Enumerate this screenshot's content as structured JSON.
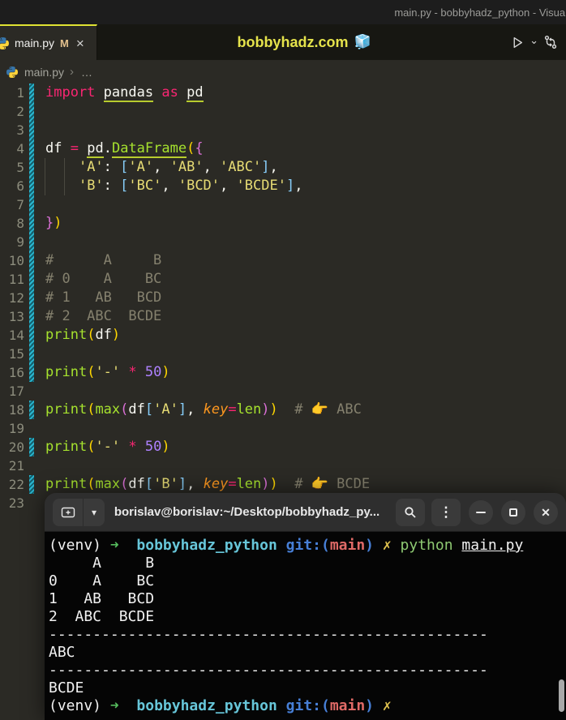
{
  "window": {
    "title": "main.py - bobbyhadz_python - Visual"
  },
  "tabbar": {
    "tab": {
      "label": "main.py",
      "modified_badge": "M",
      "close_glyph": "×"
    },
    "watermark": {
      "label": "bobbyhadz.com",
      "emoji": "🧊"
    }
  },
  "icons": {
    "run": "▷",
    "run_dropdown": "⌄",
    "terminal_dropdown": "▾",
    "menu_kebab": "⋮"
  },
  "breadcrumb": {
    "file": "main.py",
    "separator": "›",
    "ellipsis": "…"
  },
  "editor": {
    "lines": [
      {
        "n": 1,
        "mod": true,
        "seg": [
          [
            "import",
            "kw"
          ],
          [
            " ",
            "w"
          ],
          [
            "pandas",
            "wu"
          ],
          [
            " ",
            "w"
          ],
          [
            "as",
            "kw"
          ],
          [
            " ",
            "w"
          ],
          [
            "pd",
            "wu"
          ]
        ]
      },
      {
        "n": 2,
        "mod": true,
        "seg": []
      },
      {
        "n": 3,
        "mod": true,
        "seg": []
      },
      {
        "n": 4,
        "mod": true,
        "seg": [
          [
            "df",
            "w"
          ],
          [
            " ",
            "w"
          ],
          [
            "=",
            "kw"
          ],
          [
            " ",
            "w"
          ],
          [
            "pd",
            "wu"
          ],
          [
            ".",
            "w"
          ],
          [
            "DataFrame",
            "fnu"
          ],
          [
            "(",
            "b1"
          ],
          [
            "{",
            "b2"
          ]
        ]
      },
      {
        "n": 5,
        "mod": true,
        "guides": [
          13,
          37
        ],
        "seg": [
          [
            "    ",
            "w"
          ],
          [
            "'A'",
            "str"
          ],
          [
            ": ",
            "w"
          ],
          [
            "[",
            "b3"
          ],
          [
            "'A'",
            "str"
          ],
          [
            ", ",
            "w"
          ],
          [
            "'AB'",
            "str"
          ],
          [
            ", ",
            "w"
          ],
          [
            "'ABC'",
            "str"
          ],
          [
            "]",
            "b3"
          ],
          [
            ",",
            "w"
          ]
        ]
      },
      {
        "n": 6,
        "mod": true,
        "guides": [
          13,
          37
        ],
        "seg": [
          [
            "    ",
            "w"
          ],
          [
            "'B'",
            "str"
          ],
          [
            ": ",
            "w"
          ],
          [
            "[",
            "b3"
          ],
          [
            "'BC'",
            "str"
          ],
          [
            ", ",
            "w"
          ],
          [
            "'BCD'",
            "str"
          ],
          [
            ", ",
            "w"
          ],
          [
            "'BCDE'",
            "str"
          ],
          [
            "]",
            "b3"
          ],
          [
            ",",
            "w"
          ]
        ]
      },
      {
        "n": 7,
        "mod": true,
        "seg": []
      },
      {
        "n": 8,
        "mod": true,
        "seg": [
          [
            "}",
            "b2"
          ],
          [
            ")",
            "b1"
          ]
        ]
      },
      {
        "n": 9,
        "mod": true,
        "seg": []
      },
      {
        "n": 10,
        "mod": true,
        "seg": [
          [
            "#      A     B",
            "com"
          ]
        ]
      },
      {
        "n": 11,
        "mod": true,
        "seg": [
          [
            "# 0    A    BC",
            "com"
          ]
        ]
      },
      {
        "n": 12,
        "mod": true,
        "seg": [
          [
            "# 1   AB   BCD",
            "com"
          ]
        ]
      },
      {
        "n": 13,
        "mod": true,
        "seg": [
          [
            "# 2  ABC  BCDE",
            "com"
          ]
        ]
      },
      {
        "n": 14,
        "mod": true,
        "seg": [
          [
            "print",
            "fn"
          ],
          [
            "(",
            "b1"
          ],
          [
            "df",
            "w"
          ],
          [
            ")",
            "b1"
          ]
        ]
      },
      {
        "n": 15,
        "mod": true,
        "seg": []
      },
      {
        "n": 16,
        "mod": true,
        "seg": [
          [
            "print",
            "fn"
          ],
          [
            "(",
            "b1"
          ],
          [
            "'-'",
            "str"
          ],
          [
            " ",
            "w"
          ],
          [
            "*",
            "kw"
          ],
          [
            " ",
            "w"
          ],
          [
            "50",
            "num"
          ],
          [
            ")",
            "b1"
          ]
        ]
      },
      {
        "n": 17,
        "mod": false,
        "seg": []
      },
      {
        "n": 18,
        "mod": true,
        "seg": [
          [
            "print",
            "fn"
          ],
          [
            "(",
            "b1"
          ],
          [
            "max",
            "fn"
          ],
          [
            "(",
            "b2"
          ],
          [
            "df",
            "w"
          ],
          [
            "[",
            "b3"
          ],
          [
            "'A'",
            "str"
          ],
          [
            "]",
            "b3"
          ],
          [
            ", ",
            "w"
          ],
          [
            "key",
            "pr"
          ],
          [
            "=",
            "kw"
          ],
          [
            "len",
            "fn"
          ],
          [
            ")",
            "b2"
          ],
          [
            ")",
            "b1"
          ],
          [
            "  ",
            "w"
          ],
          [
            "# 👉 ABC",
            "com"
          ]
        ]
      },
      {
        "n": 19,
        "mod": false,
        "seg": []
      },
      {
        "n": 20,
        "mod": true,
        "seg": [
          [
            "print",
            "fn"
          ],
          [
            "(",
            "b1"
          ],
          [
            "'-'",
            "str"
          ],
          [
            " ",
            "w"
          ],
          [
            "*",
            "kw"
          ],
          [
            " ",
            "w"
          ],
          [
            "50",
            "num"
          ],
          [
            ")",
            "b1"
          ]
        ]
      },
      {
        "n": 21,
        "mod": false,
        "seg": []
      },
      {
        "n": 22,
        "mod": true,
        "seg": [
          [
            "print",
            "fn"
          ],
          [
            "(",
            "b1"
          ],
          [
            "max",
            "fn"
          ],
          [
            "(",
            "b2"
          ],
          [
            "df",
            "w"
          ],
          [
            "[",
            "b3"
          ],
          [
            "'B'",
            "str"
          ],
          [
            "]",
            "b3"
          ],
          [
            ", ",
            "w"
          ],
          [
            "key",
            "pr"
          ],
          [
            "=",
            "kw"
          ],
          [
            "len",
            "fn"
          ],
          [
            ")",
            "b2"
          ],
          [
            ")",
            "b1"
          ],
          [
            "  ",
            "w"
          ],
          [
            "# 👉 BCDE",
            "com"
          ]
        ]
      },
      {
        "n": 23,
        "mod": false,
        "seg": []
      }
    ]
  },
  "terminal": {
    "title": "borislav@borislav:~/Desktop/bobbyhadz_py...",
    "lines": [
      {
        "seg": [
          [
            "(venv) ",
            "w"
          ],
          [
            "➜",
            "arrow"
          ],
          [
            "  ",
            "w"
          ],
          [
            "bobbyhadz_python",
            "cyan"
          ],
          [
            " ",
            "w"
          ],
          [
            "git:(",
            "blue"
          ],
          [
            "main",
            "red"
          ],
          [
            ")",
            "blue"
          ],
          [
            " ",
            "w"
          ],
          [
            "✗",
            "x"
          ],
          [
            " ",
            "w"
          ],
          [
            "python",
            "green"
          ],
          [
            " ",
            "w"
          ],
          [
            "main.py",
            "file"
          ]
        ]
      },
      {
        "seg": [
          [
            "     A     B",
            "w"
          ]
        ]
      },
      {
        "seg": [
          [
            "0    A    BC",
            "w"
          ]
        ]
      },
      {
        "seg": [
          [
            "1   AB   BCD",
            "w"
          ]
        ]
      },
      {
        "seg": [
          [
            "2  ABC  BCDE",
            "w"
          ]
        ]
      },
      {
        "seg": [
          [
            "--------------------------------------------------",
            "w"
          ]
        ]
      },
      {
        "seg": [
          [
            "ABC",
            "w"
          ]
        ]
      },
      {
        "seg": [
          [
            "--------------------------------------------------",
            "w"
          ]
        ]
      },
      {
        "seg": [
          [
            "BCDE",
            "w"
          ]
        ]
      },
      {
        "seg": [
          [
            "(venv) ",
            "w"
          ],
          [
            "➜",
            "arrow"
          ],
          [
            "  ",
            "w"
          ],
          [
            "bobbyhadz_python",
            "cyan"
          ],
          [
            " ",
            "w"
          ],
          [
            "git:(",
            "blue"
          ],
          [
            "main",
            "red"
          ],
          [
            ")",
            "blue"
          ],
          [
            " ",
            "w"
          ],
          [
            "✗",
            "x"
          ]
        ]
      }
    ]
  },
  "colors": {
    "editor_background": "#2b2a25",
    "tab_accent_yellow": "#dfe232",
    "watermark_yellow": "#e5e34b",
    "modified_badge": "#e2c08d",
    "git_modified_gutter": "#2ab6cf",
    "keyword_pink": "#f92672",
    "string_yellow": "#e6db74",
    "function_green": "#a6e22e",
    "number_purple": "#ae81ff",
    "comment_gray": "#85816e",
    "bracket_gold": "#ffd700",
    "bracket_orchid": "#da70d6",
    "bracket_blue": "#87cefa",
    "prompt_cyan": "#67c6d9",
    "prompt_blue": "#477fd6",
    "prompt_red": "#e06a67",
    "prompt_green": "#55bb5d",
    "terminal_background": "#050505"
  }
}
